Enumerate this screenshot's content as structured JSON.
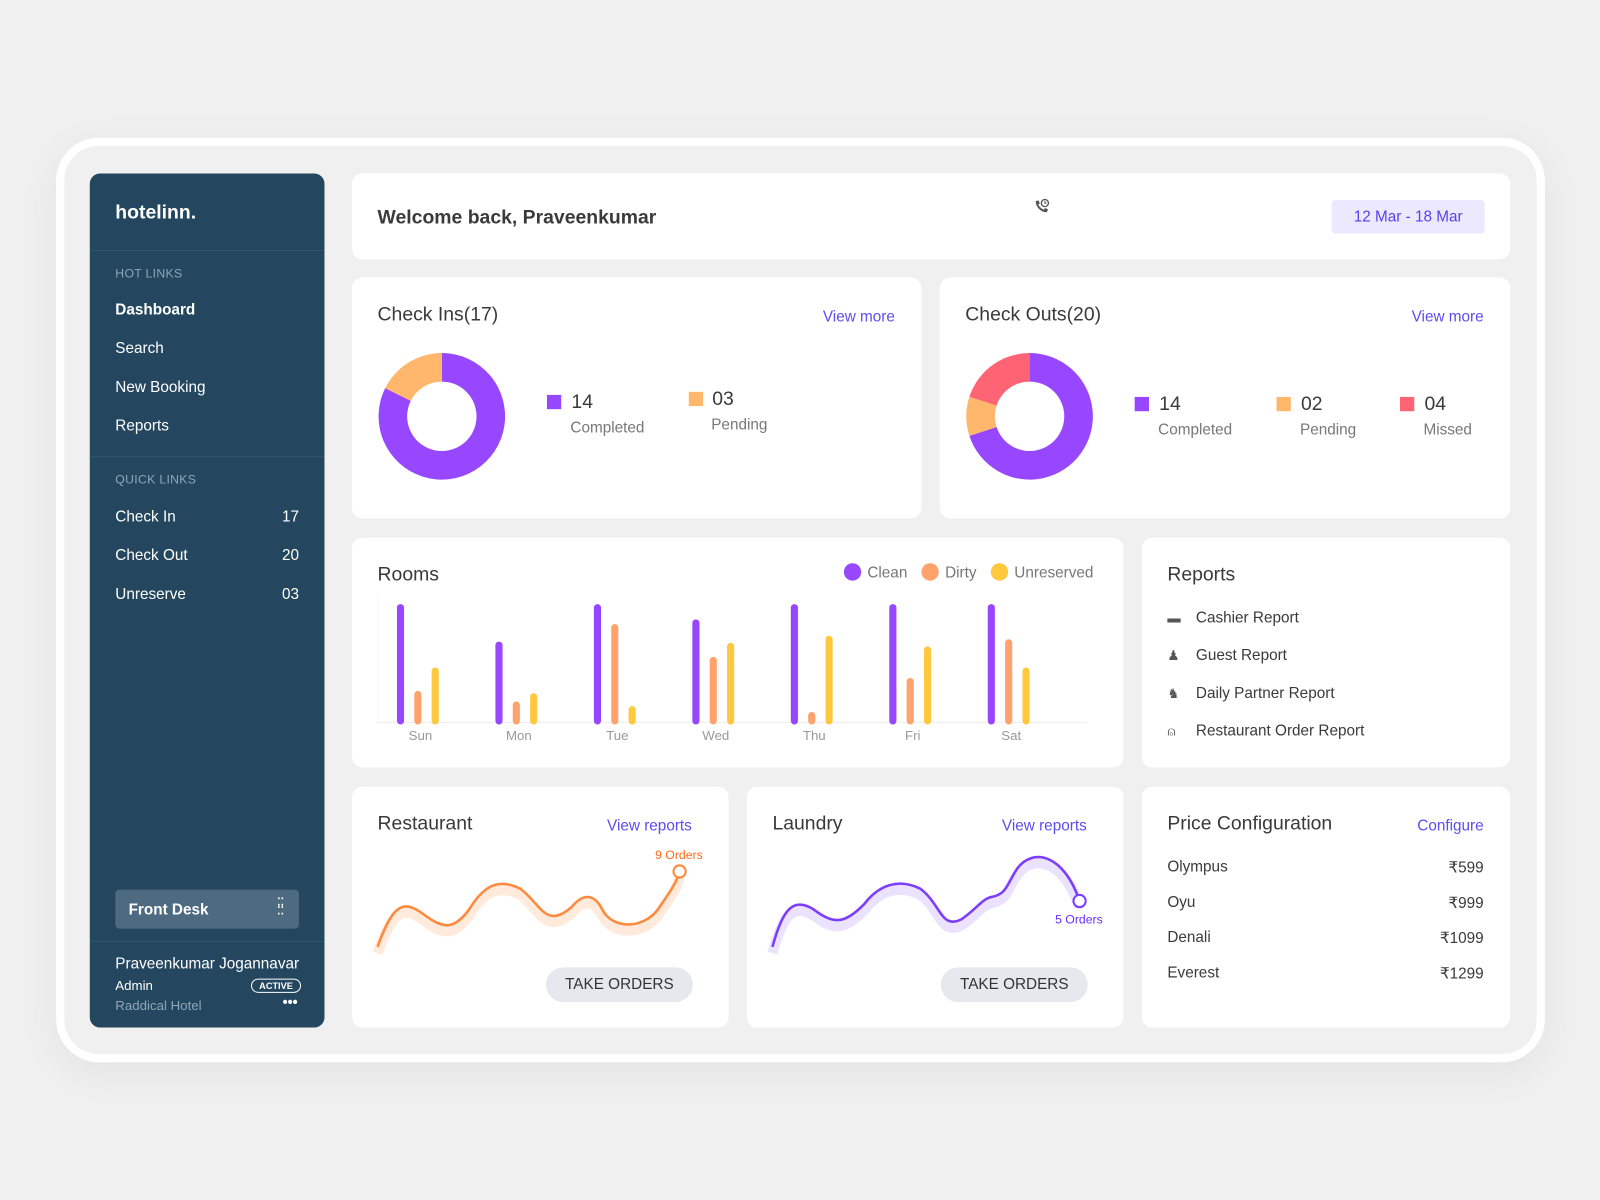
{
  "sidebar": {
    "logo": "hotelinn.",
    "hot_links_title": "HOT LINKS",
    "hot_links": [
      {
        "label": "Dashboard",
        "active": true
      },
      {
        "label": "Search"
      },
      {
        "label": "New Booking"
      },
      {
        "label": "Reports"
      }
    ],
    "quick_links_title": "QUICK LINKS",
    "quick_links": [
      {
        "label": "Check In",
        "count": "17"
      },
      {
        "label": "Check Out",
        "count": "20"
      },
      {
        "label": "Unreserve",
        "count": "03"
      }
    ],
    "role_select": "Front Desk",
    "user": {
      "name": "Praveenkumar Jogannavar",
      "role": "Admin",
      "status": "ACTIVE",
      "hotel": "Raddical Hotel"
    }
  },
  "header": {
    "welcome": "Welcome back, Praveenkumar",
    "date_range": "12 Mar - 18 Mar",
    "icon": "phone-clock-icon"
  },
  "checkins": {
    "title": "Check Ins(17)",
    "link": "View more",
    "items": [
      {
        "value": "14",
        "label": "Completed",
        "color": "#9747ff"
      },
      {
        "value": "03",
        "label": "Pending",
        "color": "#ffb86b"
      }
    ]
  },
  "checkouts": {
    "title": "Check Outs(20)",
    "link": "View more",
    "items": [
      {
        "value": "14",
        "label": "Completed",
        "color": "#9747ff"
      },
      {
        "value": "02",
        "label": "Pending",
        "color": "#ffb86b"
      },
      {
        "value": "04",
        "label": "Missed",
        "color": "#ff6474"
      }
    ]
  },
  "chart_data": {
    "type": "bar",
    "title": "Rooms",
    "categories": [
      "Sun",
      "Mon",
      "Tue",
      "Wed",
      "Thu",
      "Fri",
      "Sat"
    ],
    "series": [
      {
        "name": "Clean",
        "color": "#9747ff",
        "values": [
          100,
          68,
          100,
          87,
          100,
          100,
          100
        ]
      },
      {
        "name": "Dirty",
        "color": "#ffa26b",
        "values": [
          26,
          17,
          83,
          55,
          8,
          37,
          70
        ]
      },
      {
        "name": "Unreserved",
        "color": "#ffc83d",
        "values": [
          46,
          24,
          13,
          67,
          73,
          64,
          46
        ]
      }
    ],
    "ylim": [
      0,
      100
    ],
    "grid": false,
    "legend": "top-right"
  },
  "reports": {
    "title": "Reports",
    "items": [
      {
        "label": "Cashier Report",
        "icon": "cashier-icon"
      },
      {
        "label": "Guest Report",
        "icon": "guests-icon"
      },
      {
        "label": "Daily Partner Report",
        "icon": "partner-icon"
      },
      {
        "label": "Restaurant Order Report",
        "icon": "service-bell-icon"
      }
    ]
  },
  "restaurant": {
    "title": "Restaurant",
    "link": "View reports",
    "annotation": "9 Orders",
    "button": "TAKE ORDERS",
    "color": "#ff8a3d"
  },
  "laundry": {
    "title": "Laundry",
    "link": "View reports",
    "annotation": "5 Orders",
    "button": "TAKE ORDERS",
    "color": "#7b3dff"
  },
  "price": {
    "title": "Price Configuration",
    "link": "Configure",
    "items": [
      {
        "name": "Olympus",
        "price": "₹599"
      },
      {
        "name": "Oyu",
        "price": "₹999"
      },
      {
        "name": "Denali",
        "price": "₹1099"
      },
      {
        "name": "Everest",
        "price": "₹1299"
      }
    ]
  }
}
